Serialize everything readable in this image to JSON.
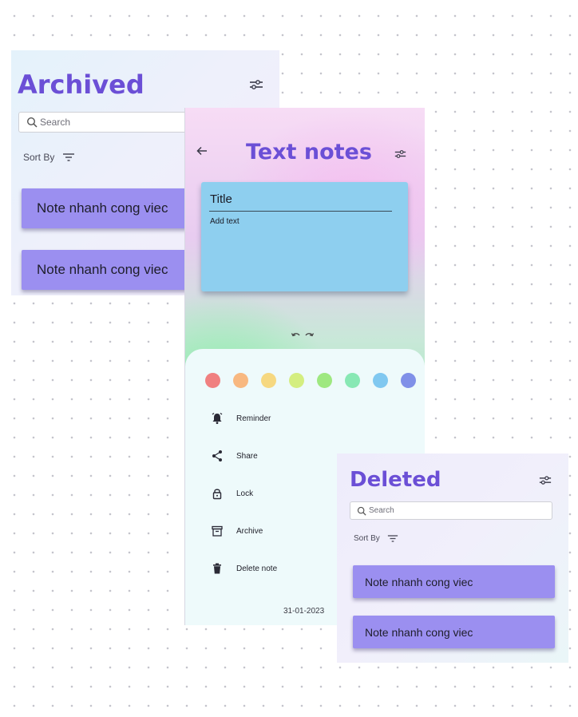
{
  "archived": {
    "title": "Archived",
    "search_placeholder": "Search",
    "sort_label": "Sort By",
    "notes": [
      "Note nhanh cong viec",
      "Note nhanh cong viec"
    ]
  },
  "text_notes": {
    "title": "Text notes",
    "card": {
      "title_placeholder": "Title",
      "body_placeholder": "Add text"
    },
    "colors": [
      "#f08080",
      "#f8b880",
      "#f6d880",
      "#d4ee80",
      "#9ee880",
      "#88e8b4",
      "#80c8f0",
      "#8090e8"
    ],
    "menu": [
      {
        "icon": "reminder-icon",
        "label": "Reminder"
      },
      {
        "icon": "share-icon",
        "label": "Share"
      },
      {
        "icon": "lock-icon",
        "label": "Lock"
      },
      {
        "icon": "archive-icon",
        "label": "Archive"
      },
      {
        "icon": "delete-icon",
        "label": "Delete note"
      }
    ],
    "date": "31-01-2023"
  },
  "deleted": {
    "title": "Deleted",
    "search_placeholder": "Search",
    "sort_label": "Sort By",
    "notes": [
      "Note nhanh cong viec",
      "Note nhanh cong viec"
    ]
  },
  "colors": {
    "accent": "#6b4fd6",
    "note_card": "#9b8ff0",
    "edit_card": "#8ecfef"
  }
}
